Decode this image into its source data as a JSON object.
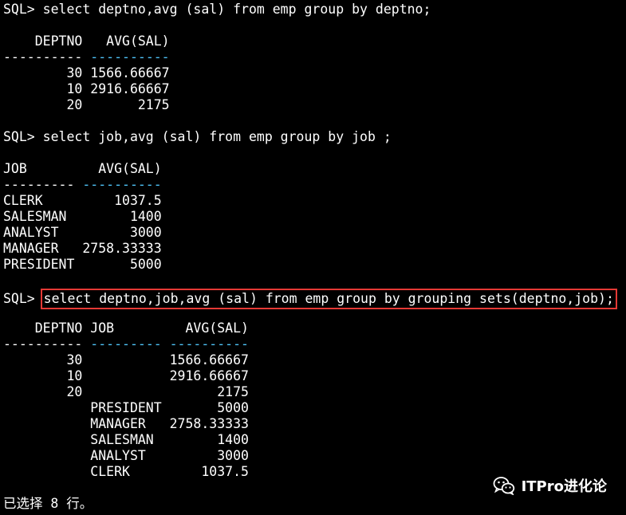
{
  "terminal": {
    "query1": {
      "prompt": "SQL> ",
      "command": "select deptno,avg (sal) from emp group by deptno;",
      "header": "    DEPTNO   AVG(SAL)",
      "sep_white": "----------",
      "sep_cyan": " ----------",
      "rows": [
        "        30 1566.66667",
        "        10 2916.66667",
        "        20       2175"
      ]
    },
    "query2": {
      "prompt": "SQL> ",
      "command": "select job,avg (sal) from emp group by job ;",
      "header": "JOB         AVG(SAL)",
      "sep_white": "---------",
      "sep_cyan": " ----------",
      "rows": [
        "CLERK         1037.5",
        "SALESMAN        1400",
        "ANALYST         3000",
        "MANAGER   2758.33333",
        "PRESIDENT       5000"
      ]
    },
    "query3": {
      "prompt": "SQL> ",
      "command": "select deptno,job,avg (sal) from emp group by grouping sets(deptno,job);",
      "header": "    DEPTNO JOB         AVG(SAL)",
      "sep_white": "----------",
      "sep_cyan": " --------- ----------",
      "rows": [
        "        30           1566.66667",
        "        10           2916.66667",
        "        20                 2175",
        "           PRESIDENT       5000",
        "           MANAGER   2758.33333",
        "           SALESMAN        1400",
        "           ANALYST         3000",
        "           CLERK         1037.5"
      ]
    },
    "footer": "已选择 8 行。"
  },
  "watermark": {
    "text": "ITPro进化论",
    "icon": "wechat-icon"
  },
  "colors": {
    "background": "#000000",
    "text": "#ffffff",
    "separator_accent": "#4fc3f7",
    "highlight_border": "#e53935"
  }
}
